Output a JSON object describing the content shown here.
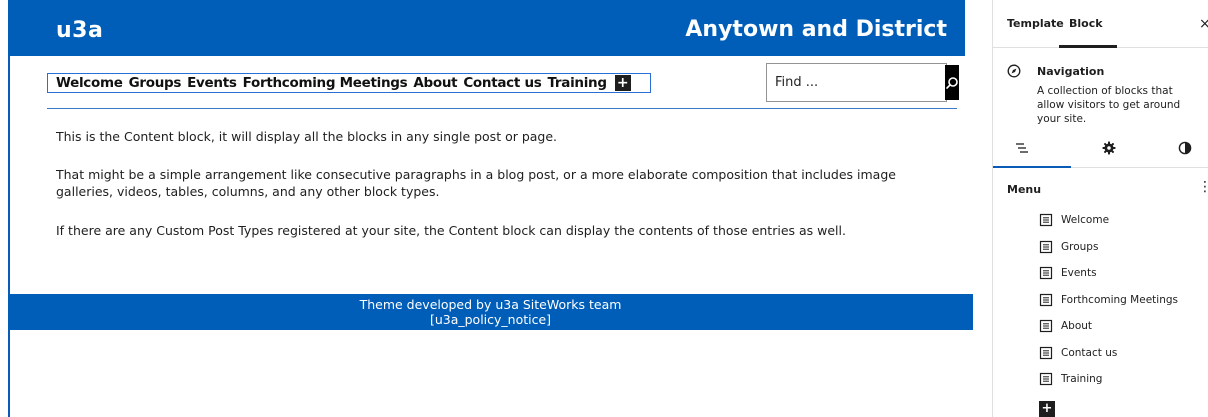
{
  "header": {
    "site_title": "u3a",
    "site_tagline": "Anytown and District"
  },
  "navigation": {
    "links": [
      "Welcome",
      "Groups",
      "Events",
      "Forthcoming Meetings",
      "About",
      "Contact us",
      "Training"
    ],
    "add_label": "+"
  },
  "search": {
    "placeholder": "Find ...",
    "icon": "search-icon"
  },
  "content": {
    "p1": "This is the Content block, it will display all the blocks in any single post or page.",
    "p2": "That might be a simple arrangement like consecutive paragraphs in a blog post, or a more elaborate composition that includes image galleries, videos, tables, columns, and any other block types.",
    "p3": "If there are any Custom Post Types registered at your site, the Content block can display the contents of those entries as well."
  },
  "footer": {
    "line1": "Theme developed by u3a SiteWorks team",
    "line2": "[u3a_policy_notice]"
  },
  "sidebar": {
    "tabs": [
      "Template",
      "Block"
    ],
    "active_tab": "Block",
    "close_label": "×",
    "block_card": {
      "title": "Navigation",
      "description": "A collection of blocks that allow visitors to get around your site.",
      "icon": "navigation-compass-icon"
    },
    "subtabs": [
      "list-view-icon",
      "settings-gear-icon",
      "styles-contrast-icon"
    ],
    "menu": {
      "header": "Menu",
      "more_label": "⋮",
      "items": [
        "Welcome",
        "Groups",
        "Events",
        "Forthcoming Meetings",
        "About",
        "Contact us",
        "Training"
      ],
      "item_icon": "page-icon",
      "add_label": "+"
    }
  },
  "colors": {
    "brand_blue": "#005eb8",
    "text_dark": "#1e1e1e",
    "selection_blue": "#2a6fd6"
  }
}
